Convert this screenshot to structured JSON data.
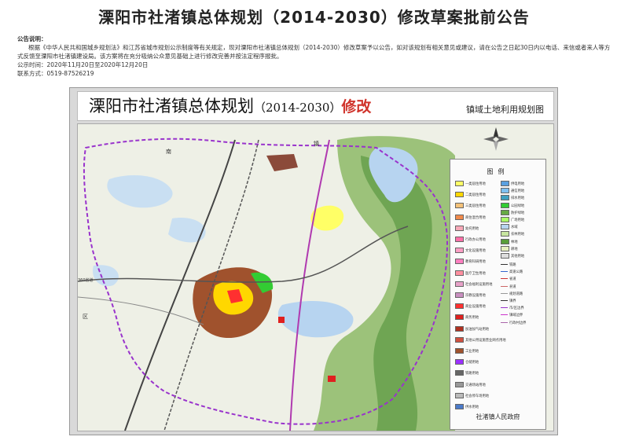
{
  "page_title": "溧阳市社渚镇总体规划（2014-2030）修改草案批前公告",
  "notice": {
    "heading": "公告说明：",
    "body": "根据《中华人民共和国城乡规划法》和江苏省城市规划公示制度等有关规定，现对溧阳市社渚镇总体规划（2014-2030）修改草案予以公告，如对该规划有相关意见或建议，请在公告之日起30日内以电话、来信或者来人等方式反馈至溧阳市社渚镇建设局。该方案将在充分吸纳公众意见基础上进行修改完善并按法定程序报批。",
    "period": "公示时间：2020年11月20日至2020年12月20日",
    "contact": "联系方式：0519-87526219"
  },
  "map": {
    "title_main": "溧阳市社渚镇总体规划",
    "title_years": "（2014-2030）",
    "title_revision": "修改",
    "subtitle": "镇域土地利用规划图",
    "labels": {
      "north": "南",
      "town": "镇",
      "west": "区",
      "road": "360省道"
    }
  },
  "legend": {
    "title": "图例",
    "left_items": [
      {
        "label": "一类居住用地",
        "color": "#ffff66"
      },
      {
        "label": "二类居住用地",
        "color": "#ffd700"
      },
      {
        "label": "三类居住用地",
        "color": "#f4c27a"
      },
      {
        "label": "商住混合用地",
        "color": "#f08a4b"
      },
      {
        "label": "幼托用地",
        "color": "#f7a8b8"
      },
      {
        "label": "行政办公用地",
        "color": "#ff6fa8"
      },
      {
        "label": "文化设施用地",
        "color": "#ff9ec4"
      },
      {
        "label": "教育科研用地",
        "color": "#ff7fbf"
      },
      {
        "label": "医疗卫生用地",
        "color": "#ff8fa0"
      },
      {
        "label": "社会福利设施用地",
        "color": "#e8a2c9"
      },
      {
        "label": "宗教设施用地",
        "color": "#c98fc0"
      },
      {
        "label": "商业设施用地",
        "color": "#ff3030"
      },
      {
        "label": "商务用地",
        "color": "#e0201f"
      },
      {
        "label": "加油加气站用地",
        "color": "#b03020"
      },
      {
        "label": "其他公用设施营业网点用地",
        "color": "#d05040"
      },
      {
        "label": "工业用地",
        "color": "#a0522d"
      },
      {
        "label": "仓储用地",
        "color": "#9b30ff"
      },
      {
        "label": "铁路用地",
        "color": "#666666"
      },
      {
        "label": "交通场站用地",
        "color": "#999999"
      },
      {
        "label": "社会停车场用地",
        "color": "#bbbbbb"
      },
      {
        "label": "供水用地",
        "color": "#4a7ac9"
      }
    ],
    "right_items": [
      {
        "label": "供电用地",
        "color": "#5aa0e0"
      },
      {
        "label": "通信用地",
        "color": "#7fc0f0"
      },
      {
        "label": "排水用地",
        "color": "#3fa0c0"
      },
      {
        "label": "公园绿地",
        "color": "#33cc33"
      },
      {
        "label": "防护绿地",
        "color": "#66aa44"
      },
      {
        "label": "广场用地",
        "color": "#aaff66"
      },
      {
        "label": "水域",
        "color": "#b7d4f0"
      },
      {
        "label": "农林用地",
        "color": "#c8e6a0"
      },
      {
        "label": "林地",
        "color": "#5a9e3a"
      },
      {
        "label": "耕地",
        "color": "#e8f0c0"
      },
      {
        "label": "其他用地",
        "color": "#dddddd"
      }
    ],
    "line_items": [
      {
        "label": "铁路",
        "color": "#333333"
      },
      {
        "label": "高速公路",
        "color": "#3366cc"
      },
      {
        "label": "省道",
        "color": "#cc3333"
      },
      {
        "label": "县道",
        "color": "#cc6666"
      },
      {
        "label": "规划道路",
        "color": "#999999"
      },
      {
        "label": "镇界",
        "color": "#333333"
      },
      {
        "label": "市/区边界",
        "color": "#9933cc"
      },
      {
        "label": "镇域边界",
        "color": "#cc33cc"
      },
      {
        "label": "行政村边界",
        "color": "#aa66aa"
      }
    ],
    "footer": "社渚镇人民政府"
  }
}
